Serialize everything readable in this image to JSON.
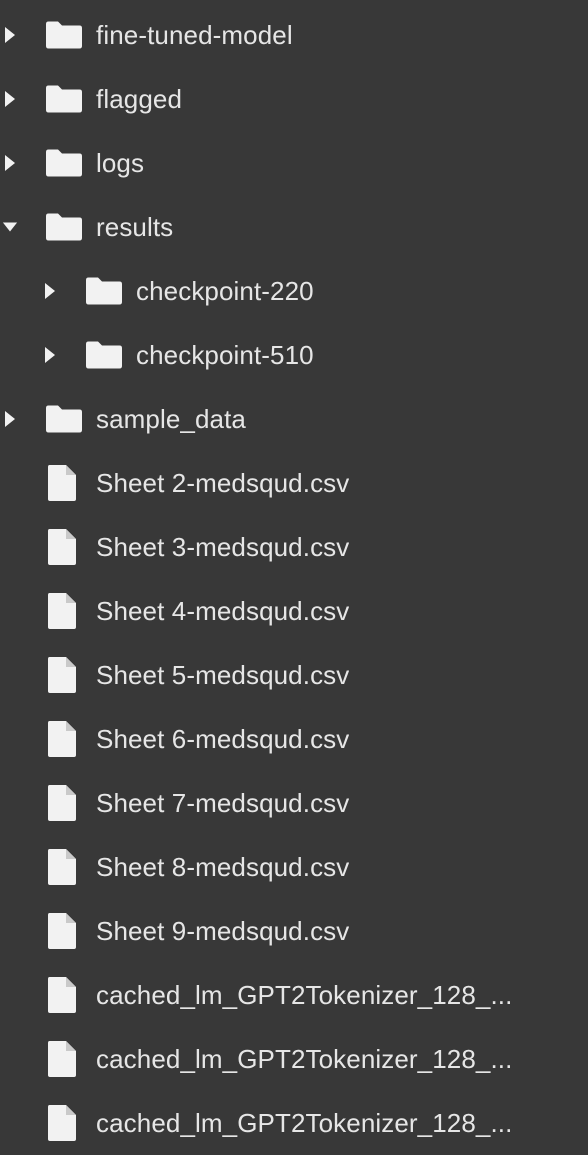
{
  "file_tree": {
    "items": [
      {
        "label": "fine-tuned-model",
        "type": "folder",
        "depth": 0,
        "expanded": false,
        "icon": "folder-icon"
      },
      {
        "label": "flagged",
        "type": "folder",
        "depth": 0,
        "expanded": false,
        "icon": "folder-icon"
      },
      {
        "label": "logs",
        "type": "folder",
        "depth": 0,
        "expanded": false,
        "icon": "folder-icon"
      },
      {
        "label": "results",
        "type": "folder",
        "depth": 0,
        "expanded": true,
        "icon": "folder-icon"
      },
      {
        "label": "checkpoint-220",
        "type": "folder",
        "depth": 1,
        "expanded": false,
        "icon": "folder-icon"
      },
      {
        "label": "checkpoint-510",
        "type": "folder",
        "depth": 1,
        "expanded": false,
        "icon": "folder-icon"
      },
      {
        "label": "sample_data",
        "type": "folder",
        "depth": 0,
        "expanded": false,
        "icon": "folder-icon"
      },
      {
        "label": "Sheet 2-medsqud.csv",
        "type": "file",
        "depth": 0,
        "icon": "file-icon"
      },
      {
        "label": "Sheet 3-medsqud.csv",
        "type": "file",
        "depth": 0,
        "icon": "file-icon"
      },
      {
        "label": "Sheet 4-medsqud.csv",
        "type": "file",
        "depth": 0,
        "icon": "file-icon"
      },
      {
        "label": "Sheet 5-medsqud.csv",
        "type": "file",
        "depth": 0,
        "icon": "file-icon"
      },
      {
        "label": "Sheet 6-medsqud.csv",
        "type": "file",
        "depth": 0,
        "icon": "file-icon"
      },
      {
        "label": "Sheet 7-medsqud.csv",
        "type": "file",
        "depth": 0,
        "icon": "file-icon"
      },
      {
        "label": "Sheet 8-medsqud.csv",
        "type": "file",
        "depth": 0,
        "icon": "file-icon"
      },
      {
        "label": "Sheet 9-medsqud.csv",
        "type": "file",
        "depth": 0,
        "icon": "file-icon"
      },
      {
        "label": "cached_lm_GPT2Tokenizer_128_...",
        "type": "file",
        "depth": 0,
        "icon": "file-icon"
      },
      {
        "label": "cached_lm_GPT2Tokenizer_128_...",
        "type": "file",
        "depth": 0,
        "icon": "file-icon"
      },
      {
        "label": "cached_lm_GPT2Tokenizer_128_...",
        "type": "file",
        "depth": 0,
        "icon": "file-icon"
      }
    ]
  },
  "colors": {
    "background": "#383838",
    "icon": "#f2f2f2",
    "text": "#e6e6e6"
  }
}
